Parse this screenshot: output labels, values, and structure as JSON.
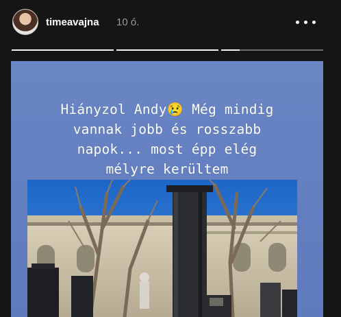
{
  "header": {
    "username": "timeavajna",
    "timestamp": "10 ó.",
    "more_icon": "more-horizontal-icon",
    "progress": [
      1,
      1,
      0.18
    ]
  },
  "story": {
    "caption": "Hiányzol Andy😢 Még mindig\nvannak jobb és rosszabb\nnapok... most épp elég\nmélyre kerültem",
    "background_color": "#6480c1",
    "photo_description_icon": "cemetery-photo"
  }
}
